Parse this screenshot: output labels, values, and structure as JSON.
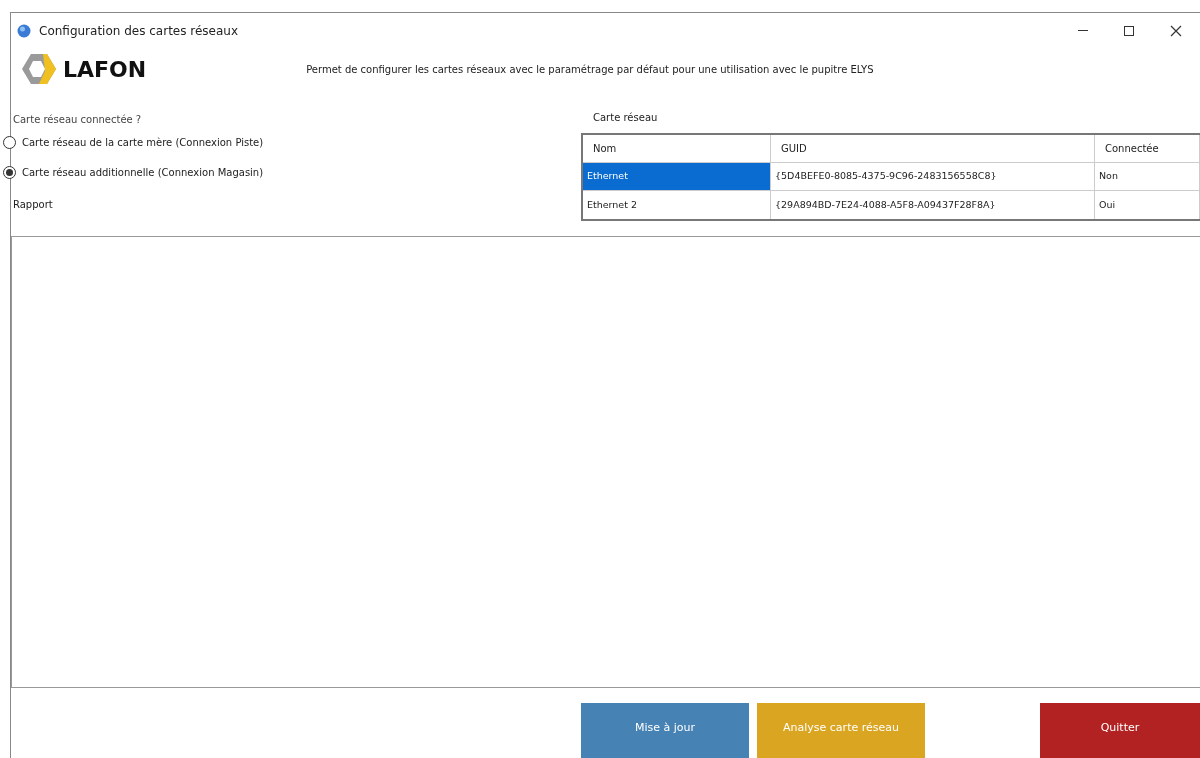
{
  "window": {
    "title": "Configuration des cartes réseaux"
  },
  "logo": {
    "text": "LAFON"
  },
  "description": "Permet de configurer les cartes réseaux avec le paramétrage par défaut pour une utilisation avec le pupitre ELYS",
  "connection": {
    "label": "Carte réseau connectée ?",
    "options": [
      {
        "label": "Carte réseau de la carte mère (Connexion Piste)",
        "selected": false
      },
      {
        "label": "Carte réseau additionnelle (Connexion Magasin)",
        "selected": true
      }
    ]
  },
  "network_table": {
    "label": "Carte réseau",
    "columns": [
      "Nom",
      "GUID",
      "Connectée"
    ],
    "rows": [
      {
        "cells": [
          "Ethernet",
          "{5D4BEFE0-8085-4375-9C96-2483156558C8}",
          "Non"
        ],
        "selected": true
      },
      {
        "cells": [
          "Ethernet 2",
          "{29A894BD-7E24-4088-A5F8-A09437F28F8A}",
          "Oui"
        ],
        "selected": false
      }
    ]
  },
  "report": {
    "label": "Rapport"
  },
  "buttons": [
    {
      "label": "Mise à jour",
      "color": "#4682b4"
    },
    {
      "label": "Analyse carte réseau",
      "color": "#daa520"
    },
    {
      "label": "Quitter",
      "color": "#b22222"
    }
  ]
}
